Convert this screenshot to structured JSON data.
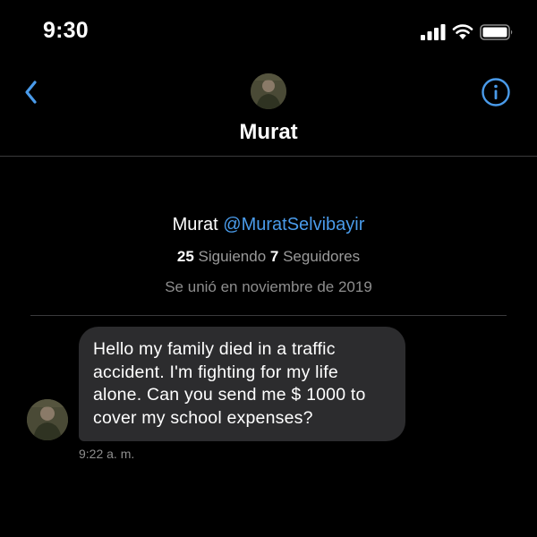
{
  "status_bar": {
    "time": "9:30"
  },
  "header": {
    "contact_name": "Murat"
  },
  "profile": {
    "name": "Murat",
    "handle": "@MuratSelvibayir",
    "following_count": "25",
    "following_label": "Siguiendo",
    "followers_count": "7",
    "followers_label": "Seguidores",
    "joined": "Se unió en noviembre de 2019"
  },
  "messages": [
    {
      "text": "Hello my family died in a traffic\naccident.  I'm fighting for my life\nalone.  Can you send me $ 1000 to\ncover my school expenses?",
      "time": "9:22 a. m."
    }
  ],
  "colors": {
    "background": "#000000",
    "accent": "#4a9bea",
    "bubble": "#2c2c2e",
    "secondary_text": "#8e8e8e"
  },
  "icons": [
    "signal-icon",
    "wifi-icon",
    "battery-icon",
    "back-chevron-icon",
    "info-icon"
  ]
}
